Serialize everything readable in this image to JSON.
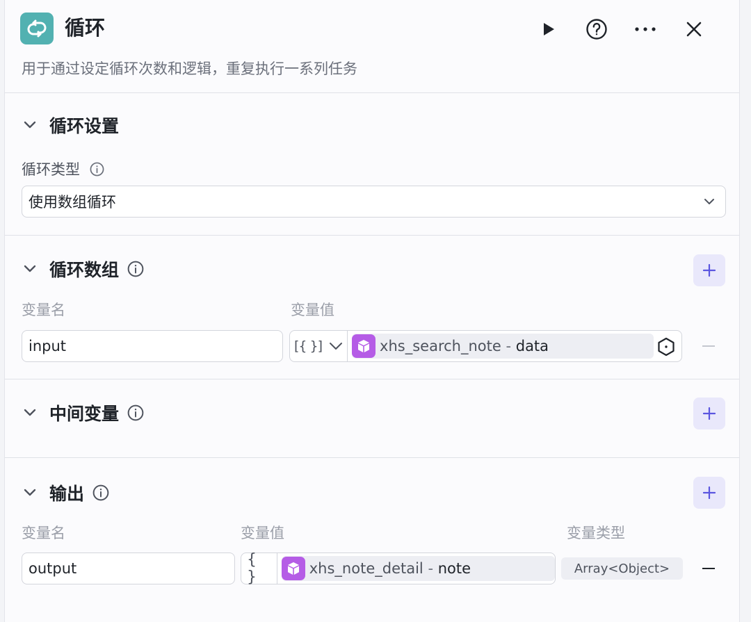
{
  "header": {
    "title": "循环",
    "description": "用于通过设定循环次数和逻辑，重复执行一系列任务"
  },
  "loop_settings": {
    "title": "循环设置",
    "type_label": "循环类型",
    "type_value": "使用数组循环"
  },
  "loop_array": {
    "title": "循环数组",
    "col_name": "变量名",
    "col_value": "变量值",
    "rows": [
      {
        "name": "input",
        "type_symbol": "[{ }]",
        "ref_node": "xhs_search_note",
        "ref_sep": " - ",
        "ref_attr": "data"
      }
    ]
  },
  "intermediate": {
    "title": "中间变量"
  },
  "output": {
    "title": "输出",
    "col_name": "变量名",
    "col_value": "变量值",
    "col_type": "变量类型",
    "rows": [
      {
        "name": "output",
        "type_symbol": "{ }",
        "ref_node": "xhs_note_detail",
        "ref_sep": " - ",
        "ref_attr": "note",
        "var_type": "Array<Object>"
      }
    ]
  },
  "colors": {
    "node_icon_bg": "#52b1b1",
    "ref_icon_bg": "#b55ce6",
    "add_button_bg": "#e9e8fb",
    "accent": "#5b56e0"
  }
}
